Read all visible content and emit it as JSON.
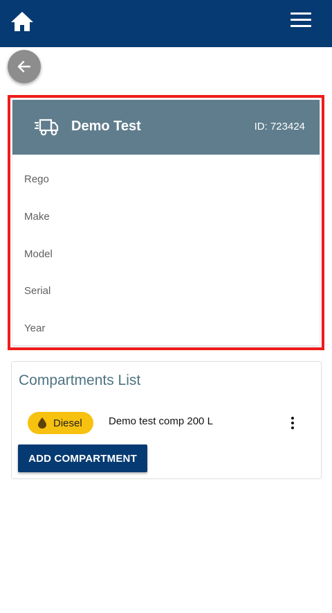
{
  "header": {
    "home_icon": "home-icon",
    "menu_icon": "hamburger-menu-icon",
    "background": "#063a72"
  },
  "back": {
    "icon": "arrow-left-icon"
  },
  "vehicle": {
    "icon": "truck-fast-icon",
    "name": "Demo Test",
    "id_text": "ID: 723424",
    "header_color": "#5f7d8c",
    "highlight_color": "#ee1c1c",
    "fields": [
      "Rego",
      "Make",
      "Model",
      "Serial",
      "Year"
    ]
  },
  "compartments": {
    "title": "Compartments List",
    "items": [
      {
        "fuel": "Diesel",
        "fuel_icon": "fuel-drop-icon",
        "fuel_color": "#f7c10f",
        "description": "Demo test comp 200 L",
        "menu_icon": "more-vertical-icon"
      }
    ],
    "add_button": "ADD COMPARTMENT"
  }
}
